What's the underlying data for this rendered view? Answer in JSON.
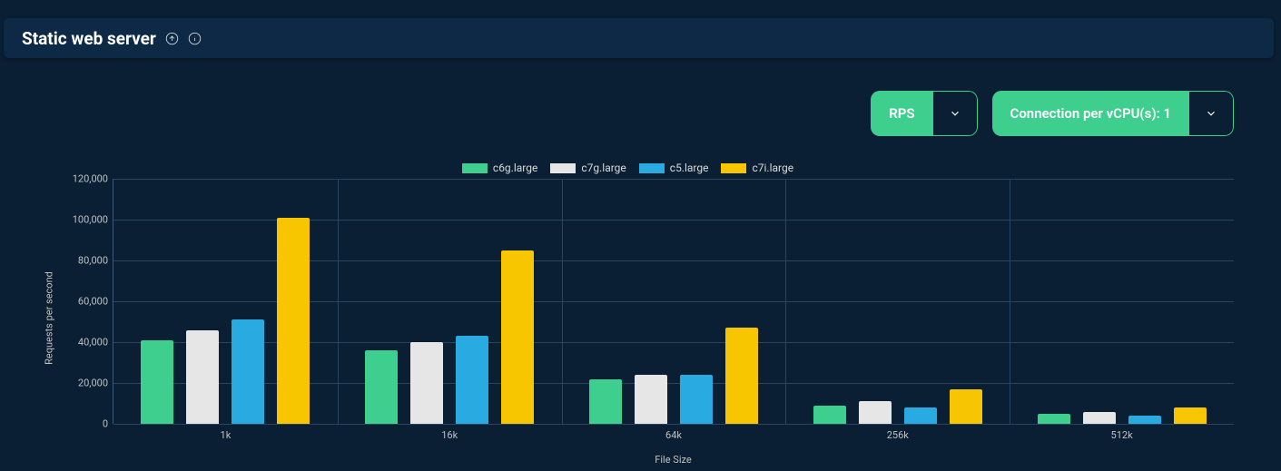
{
  "header": {
    "title": "Static web server"
  },
  "controls": {
    "metric_dropdown": {
      "label": "RPS"
    },
    "connection_dropdown": {
      "label": "Connection per vCPU(s): 1"
    }
  },
  "chart_data": {
    "type": "bar",
    "title": "",
    "xlabel": "File Size",
    "ylabel": "Requests per second",
    "ylim": [
      0,
      120000
    ],
    "yticks": [
      0,
      20000,
      40000,
      60000,
      80000,
      100000,
      120000
    ],
    "ytick_labels": [
      "0",
      "20,000",
      "40,000",
      "60,000",
      "80,000",
      "100,000",
      "120,000"
    ],
    "categories": [
      "1k",
      "16k",
      "64k",
      "256k",
      "512k"
    ],
    "series": [
      {
        "name": "c6g.large",
        "color": "#3ecf8e",
        "values": [
          41000,
          36000,
          22000,
          9000,
          5000
        ]
      },
      {
        "name": "c7g.large",
        "color": "#e6e6e6",
        "values": [
          46000,
          40000,
          24000,
          11000,
          6000
        ]
      },
      {
        "name": "c5.large",
        "color": "#29abe2",
        "values": [
          51000,
          43000,
          24000,
          8000,
          4000
        ]
      },
      {
        "name": "c7i.large",
        "color": "#f7c600",
        "values": [
          101000,
          85000,
          47000,
          17000,
          8000
        ]
      }
    ]
  }
}
